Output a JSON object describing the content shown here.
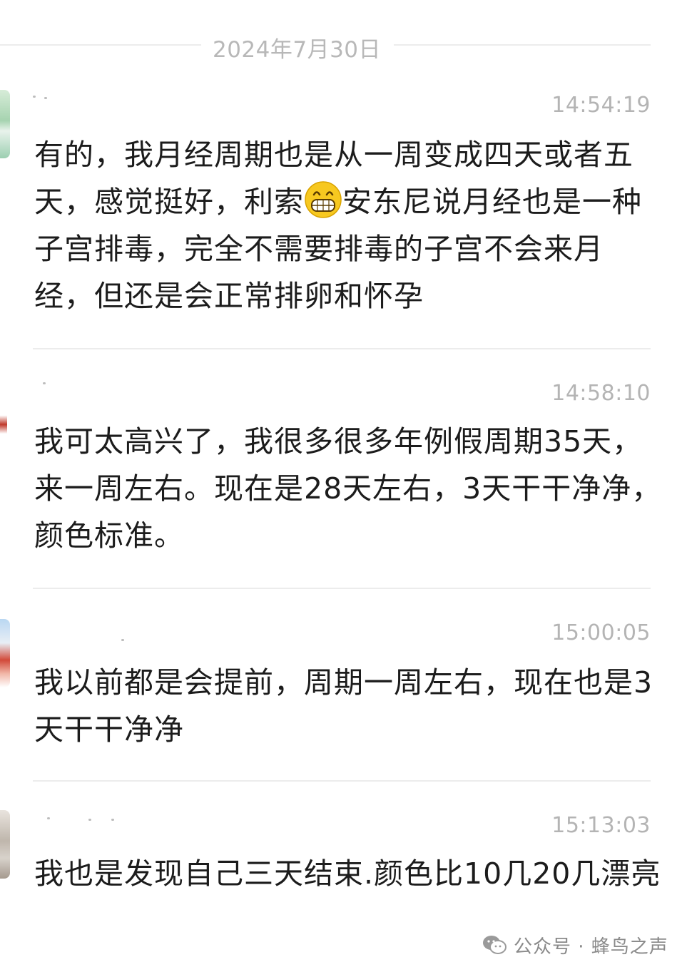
{
  "date_divider": "2024年7月30日",
  "messages": [
    {
      "time": "14:54:19",
      "text_before_emoji": "有的，我月经周期也是从一周变成四天或者五天，感觉挺好，利索",
      "emoji": "grinning-face-icon",
      "text_after_emoji": "安东尼说月经也是一种子宫排毒，完全不需要排毒的子宫不会来月经，但还是会正常排卵和怀孕"
    },
    {
      "time": "14:58:10",
      "text": "我可太高兴了，我很多很多年例假周期35天，来一周左右。现在是28天左右，3天干干净净，颜色标准。"
    },
    {
      "time": "15:00:05",
      "text": "我以前都是会提前，周期一周左右，现在也是3天干干净净"
    },
    {
      "time": "15:13:03",
      "text": "我也是发现自己三天结束.颜色比10几20几漂亮"
    }
  ],
  "watermark": {
    "icon": "wechat-icon",
    "text": "公众号 · 蜂鸟之声"
  },
  "colors": {
    "text": "#1c1c1c",
    "time": "#b4b4b4",
    "date": "#b8b8b8",
    "divider": "#ececec",
    "emoji": "#f5c518"
  }
}
